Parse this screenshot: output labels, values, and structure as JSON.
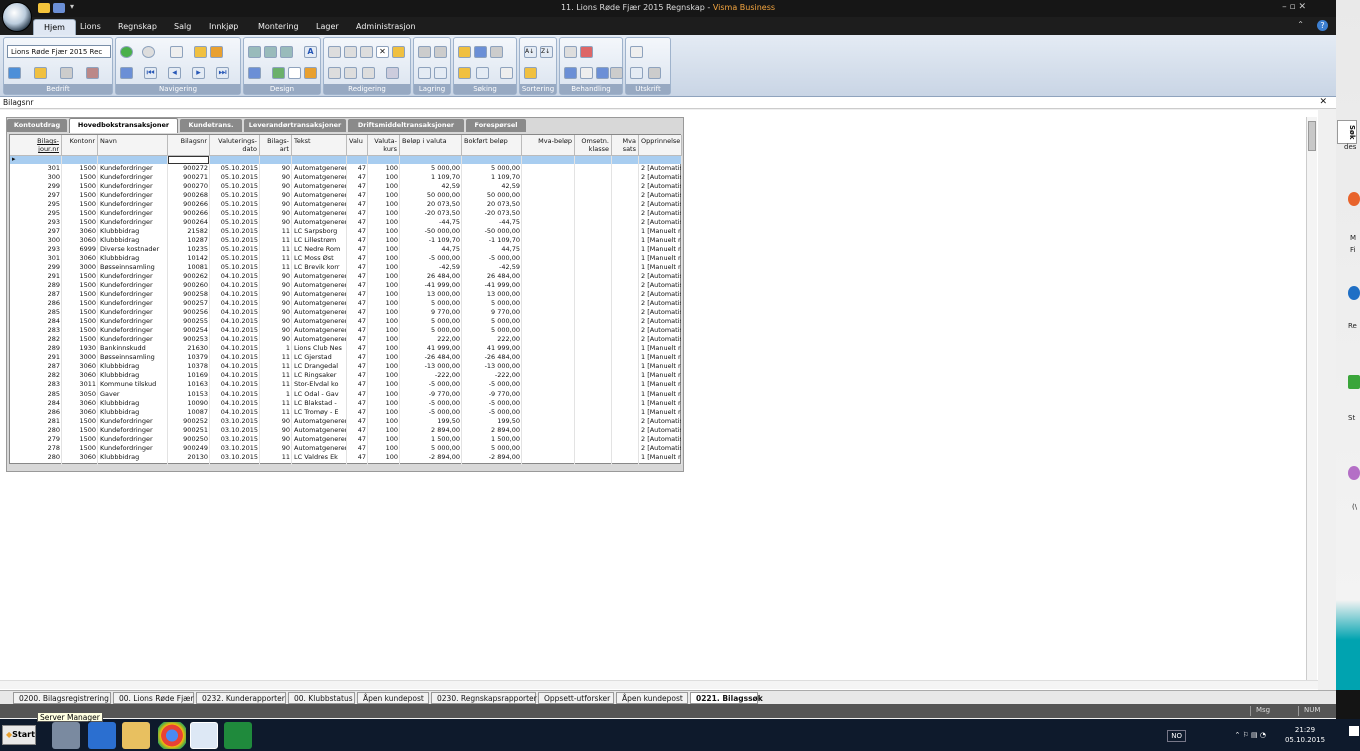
{
  "window": {
    "title_prefix": "11. Lions Røde Fjær 2015 Regnskap - ",
    "title_brand": "Visma Business",
    "controls": "– ▫ ✕"
  },
  "ribbon": {
    "tabs": [
      "Hjem",
      "Lions",
      "Regnskap",
      "Salg",
      "Innkjøp",
      "Montering",
      "Lager",
      "Administrasjon"
    ],
    "active_tab": "Hjem",
    "company_dropdown": "Lions Røde Fjær 2015 Rec",
    "groups": [
      "Bedrift",
      "Navigering",
      "Design",
      "Redigering",
      "Lagring",
      "Søking",
      "Sortering",
      "Behandling",
      "Utskrift"
    ],
    "right_glyph": "⌃"
  },
  "form": {
    "title": "Bilagsnr",
    "close": "✕"
  },
  "panel_tabs": [
    "Kontoutdrag",
    "Hovedbokstransaksjoner",
    "Kundetrans.",
    "Leverandørtransaksjoner",
    "Driftsmiddeltransaksjoner",
    "Forespørsel"
  ],
  "active_panel_tab": "Hovedbokstransaksjoner",
  "grid": {
    "row_indicator": "▸",
    "columns": [
      {
        "key": "jour",
        "label": "Bilags-\njour.nr"
      },
      {
        "key": "konto",
        "label": "Kontonr"
      },
      {
        "key": "navn",
        "label": "Navn"
      },
      {
        "key": "bilag",
        "label": "Bilagsnr"
      },
      {
        "key": "dato",
        "label": "Valuterings-\ndato"
      },
      {
        "key": "art",
        "label": "Bilags-\nart"
      },
      {
        "key": "tekst",
        "label": "Tekst"
      },
      {
        "key": "valu",
        "label": "Valu"
      },
      {
        "key": "kurs",
        "label": "Valuta-\nkurs"
      },
      {
        "key": "belop",
        "label": "Beløp i valuta"
      },
      {
        "key": "bokfort",
        "label": "Bokført beløp"
      },
      {
        "key": "mva",
        "label": "Mva-beløp"
      },
      {
        "key": "omsetn",
        "label": "Omsetn.\nklasse"
      },
      {
        "key": "mvasats",
        "label": "Mva\nsats"
      },
      {
        "key": "opprinnelse",
        "label": "Opprinnelse"
      }
    ],
    "rows": [
      [
        "301",
        "1500",
        "Kundefordringer",
        "900272",
        "05.10.2015",
        "90",
        "Automatgenerert",
        "47",
        "100",
        "5 000,00",
        "5 000,00",
        "",
        "",
        "",
        "2 [Automatis"
      ],
      [
        "300",
        "1500",
        "Kundefordringer",
        "900271",
        "05.10.2015",
        "90",
        "Automatgenerert",
        "47",
        "100",
        "1 109,70",
        "1 109,70",
        "",
        "",
        "",
        "2 [Automatis"
      ],
      [
        "299",
        "1500",
        "Kundefordringer",
        "900270",
        "05.10.2015",
        "90",
        "Automatgenerert",
        "47",
        "100",
        "42,59",
        "42,59",
        "",
        "",
        "",
        "2 [Automatis"
      ],
      [
        "297",
        "1500",
        "Kundefordringer",
        "900268",
        "05.10.2015",
        "90",
        "Automatgenerert",
        "47",
        "100",
        "50 000,00",
        "50 000,00",
        "",
        "",
        "",
        "2 [Automatis"
      ],
      [
        "295",
        "1500",
        "Kundefordringer",
        "900266",
        "05.10.2015",
        "90",
        "Automatgenerert",
        "47",
        "100",
        "20 073,50",
        "20 073,50",
        "",
        "",
        "",
        "2 [Automatis"
      ],
      [
        "295",
        "1500",
        "Kundefordringer",
        "900266",
        "05.10.2015",
        "90",
        "Automatgenerert",
        "47",
        "100",
        "-20 073,50",
        "-20 073,50",
        "",
        "",
        "",
        "2 [Automatis"
      ],
      [
        "293",
        "1500",
        "Kundefordringer",
        "900264",
        "05.10.2015",
        "90",
        "Automatgenerert",
        "47",
        "100",
        "-44,75",
        "-44,75",
        "",
        "",
        "",
        "2 [Automatis"
      ],
      [
        "297",
        "3060",
        "Klubbbidrag",
        "21582",
        "05.10.2015",
        "11",
        "LC Sarpsborg",
        "47",
        "100",
        "-50 000,00",
        "-50 000,00",
        "",
        "",
        "",
        "1 [Manuelt re"
      ],
      [
        "300",
        "3060",
        "Klubbbidrag",
        "10287",
        "05.10.2015",
        "11",
        "LC Lillestrøm",
        "47",
        "100",
        "-1 109,70",
        "-1 109,70",
        "",
        "",
        "",
        "1 [Manuelt re"
      ],
      [
        "293",
        "6999",
        "Diverse kostnader",
        "10235",
        "05.10.2015",
        "11",
        "LC Nedre Rom",
        "47",
        "100",
        "44,75",
        "44,75",
        "",
        "",
        "",
        "1 [Manuelt re"
      ],
      [
        "301",
        "3060",
        "Klubbbidrag",
        "10142",
        "05.10.2015",
        "11",
        "LC Moss Øst",
        "47",
        "100",
        "-5 000,00",
        "-5 000,00",
        "",
        "",
        "",
        "1 [Manuelt re"
      ],
      [
        "299",
        "3000",
        "Bøsseinnsamling",
        "10081",
        "05.10.2015",
        "11",
        "LC Brevik korr",
        "47",
        "100",
        "-42,59",
        "-42,59",
        "",
        "",
        "",
        "1 [Manuelt re"
      ],
      [
        "291",
        "1500",
        "Kundefordringer",
        "900262",
        "04.10.2015",
        "90",
        "Automatgenerert",
        "47",
        "100",
        "26 484,00",
        "26 484,00",
        "",
        "",
        "",
        "2 [Automatis"
      ],
      [
        "289",
        "1500",
        "Kundefordringer",
        "900260",
        "04.10.2015",
        "90",
        "Automatgenerert",
        "47",
        "100",
        "-41 999,00",
        "-41 999,00",
        "",
        "",
        "",
        "2 [Automatis"
      ],
      [
        "287",
        "1500",
        "Kundefordringer",
        "900258",
        "04.10.2015",
        "90",
        "Automatgenerert",
        "47",
        "100",
        "13 000,00",
        "13 000,00",
        "",
        "",
        "",
        "2 [Automatis"
      ],
      [
        "286",
        "1500",
        "Kundefordringer",
        "900257",
        "04.10.2015",
        "90",
        "Automatgenerert",
        "47",
        "100",
        "5 000,00",
        "5 000,00",
        "",
        "",
        "",
        "2 [Automatis"
      ],
      [
        "285",
        "1500",
        "Kundefordringer",
        "900256",
        "04.10.2015",
        "90",
        "Automatgenerert",
        "47",
        "100",
        "9 770,00",
        "9 770,00",
        "",
        "",
        "",
        "2 [Automatis"
      ],
      [
        "284",
        "1500",
        "Kundefordringer",
        "900255",
        "04.10.2015",
        "90",
        "Automatgenerert",
        "47",
        "100",
        "5 000,00",
        "5 000,00",
        "",
        "",
        "",
        "2 [Automatis"
      ],
      [
        "283",
        "1500",
        "Kundefordringer",
        "900254",
        "04.10.2015",
        "90",
        "Automatgenerert",
        "47",
        "100",
        "5 000,00",
        "5 000,00",
        "",
        "",
        "",
        "2 [Automatis"
      ],
      [
        "282",
        "1500",
        "Kundefordringer",
        "900253",
        "04.10.2015",
        "90",
        "Automatgenerert",
        "47",
        "100",
        "222,00",
        "222,00",
        "",
        "",
        "",
        "2 [Automatis"
      ],
      [
        "289",
        "1930",
        "Bankinnskudd",
        "21630",
        "04.10.2015",
        "1",
        "Lions Club Nes",
        "47",
        "100",
        "41 999,00",
        "41 999,00",
        "",
        "",
        "",
        "1 [Manuelt re"
      ],
      [
        "291",
        "3000",
        "Bøsseinnsamling",
        "10379",
        "04.10.2015",
        "11",
        "LC Gjerstad",
        "47",
        "100",
        "-26 484,00",
        "-26 484,00",
        "",
        "",
        "",
        "1 [Manuelt re"
      ],
      [
        "287",
        "3060",
        "Klubbbidrag",
        "10378",
        "04.10.2015",
        "11",
        "LC Drangedal",
        "47",
        "100",
        "-13 000,00",
        "-13 000,00",
        "",
        "",
        "",
        "1 [Manuelt re"
      ],
      [
        "282",
        "3060",
        "Klubbbidrag",
        "10169",
        "04.10.2015",
        "11",
        "LC Ringsaker",
        "47",
        "100",
        "-222,00",
        "-222,00",
        "",
        "",
        "",
        "1 [Manuelt re"
      ],
      [
        "283",
        "3011",
        "Kommune tilskud",
        "10163",
        "04.10.2015",
        "11",
        "Stor-Elvdal ko",
        "47",
        "100",
        "-5 000,00",
        "-5 000,00",
        "",
        "",
        "",
        "1 [Manuelt re"
      ],
      [
        "285",
        "3050",
        "Gaver",
        "10153",
        "04.10.2015",
        "1",
        "LC Odal - Gav",
        "47",
        "100",
        "-9 770,00",
        "-9 770,00",
        "",
        "",
        "",
        "1 [Manuelt re"
      ],
      [
        "284",
        "3060",
        "Klubbbidrag",
        "10090",
        "04.10.2015",
        "11",
        "LC Blakstad -",
        "47",
        "100",
        "-5 000,00",
        "-5 000,00",
        "",
        "",
        "",
        "1 [Manuelt re"
      ],
      [
        "286",
        "3060",
        "Klubbbidrag",
        "10087",
        "04.10.2015",
        "11",
        "LC Tromøy - E",
        "47",
        "100",
        "-5 000,00",
        "-5 000,00",
        "",
        "",
        "",
        "1 [Manuelt re"
      ],
      [
        "281",
        "1500",
        "Kundefordringer",
        "900252",
        "03.10.2015",
        "90",
        "Automatgenerert",
        "47",
        "100",
        "199,50",
        "199,50",
        "",
        "",
        "",
        "2 [Automatis"
      ],
      [
        "280",
        "1500",
        "Kundefordringer",
        "900251",
        "03.10.2015",
        "90",
        "Automatgenerert",
        "47",
        "100",
        "2 894,00",
        "2 894,00",
        "",
        "",
        "",
        "2 [Automatis"
      ],
      [
        "279",
        "1500",
        "Kundefordringer",
        "900250",
        "03.10.2015",
        "90",
        "Automatgenerert",
        "47",
        "100",
        "1 500,00",
        "1 500,00",
        "",
        "",
        "",
        "2 [Automatis"
      ],
      [
        "278",
        "1500",
        "Kundefordringer",
        "900249",
        "03.10.2015",
        "90",
        "Automatgenerert",
        "47",
        "100",
        "5 000,00",
        "5 000,00",
        "",
        "",
        "",
        "2 [Automatis"
      ],
      [
        "280",
        "3060",
        "Klubbbidrag",
        "20130",
        "03.10.2015",
        "11",
        "LC Valdres Ek",
        "47",
        "100",
        "-2 894,00",
        "-2 894,00",
        "",
        "",
        "",
        "1 [Manuelt re"
      ]
    ]
  },
  "bottom_tabs": [
    "0200. Bilagsregistrering",
    "00. Lions Røde Fjær",
    "0232. Kunderapporter",
    "00. Klubbstatus",
    "Åpen kundepost",
    "0230. Regnskapsrapporter",
    "Oppsett-utforsker",
    "Åpen kundepost",
    "0221. Bilagssøk"
  ],
  "active_bottom_tab": "0221. Bilagssøk",
  "status": {
    "msg": "Msg",
    "num": "NUM"
  },
  "side_panel": {
    "label": "Søk"
  },
  "taskbar": {
    "start": "Start",
    "tooltip": "Server Manager",
    "language": "NO",
    "time": "21:29",
    "date": "05.10.2015",
    "tray_icons": "⌃ ⚐ ▤ ◔"
  },
  "desktop": {
    "labels": [
      "des",
      "M",
      "Fi",
      "Re",
      "St",
      "(\\"
    ]
  }
}
